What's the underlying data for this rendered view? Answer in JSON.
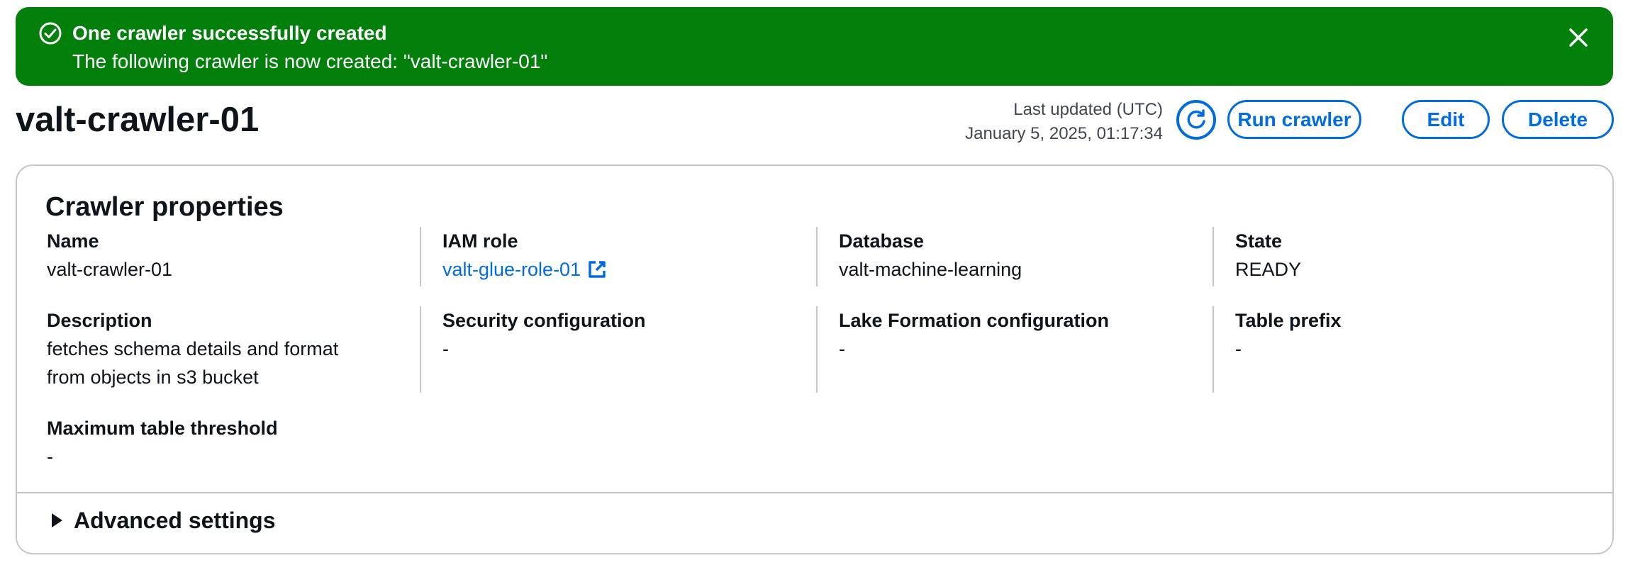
{
  "flash": {
    "title": "One crawler successfully created",
    "message": "The following crawler is now created: \"valt-crawler-01\"",
    "icon": "check-circle-icon",
    "close_icon": "close-icon",
    "background_color": "#037f0c"
  },
  "header": {
    "title": "valt-crawler-01",
    "last_updated_label": "Last updated (UTC)",
    "last_updated_value": "January 5, 2025, 01:17:34",
    "refresh_icon": "refresh-icon",
    "buttons": {
      "run": "Run crawler",
      "edit": "Edit",
      "delete": "Delete"
    },
    "accent_color": "#006ce0"
  },
  "properties": {
    "title": "Crawler properties",
    "fields": [
      {
        "label": "Name",
        "value": "valt-crawler-01"
      },
      {
        "label": "IAM role",
        "value": "valt-glue-role-01",
        "icon": "external-link-icon"
      },
      {
        "label": "Database",
        "value": "valt-machine-learning"
      },
      {
        "label": "State",
        "value": "READY"
      },
      {
        "label": "Description",
        "value": "fetches schema details and format from objects in s3 bucket"
      },
      {
        "label": "Security configuration",
        "value": "-"
      },
      {
        "label": "Lake Formation configuration",
        "value": "-"
      },
      {
        "label": "Table prefix",
        "value": "-"
      },
      {
        "label": "Maximum table threshold",
        "value": "-"
      }
    ],
    "advanced_label": "Advanced settings",
    "advanced_icon": "caret-right-icon"
  }
}
